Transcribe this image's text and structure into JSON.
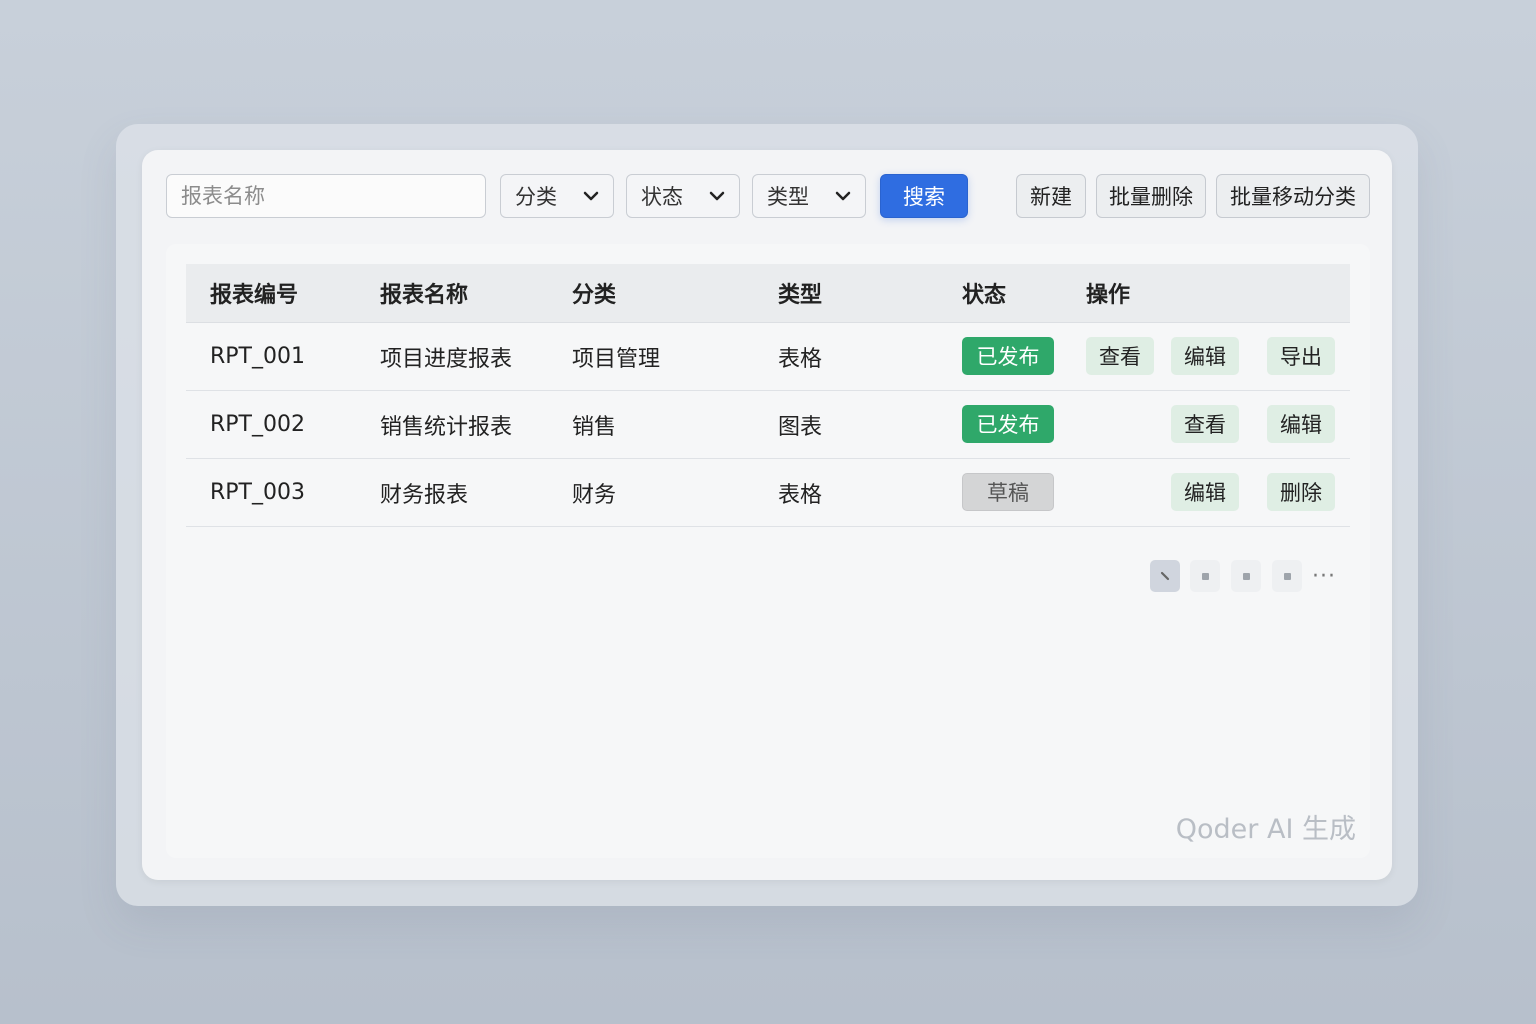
{
  "toolbar": {
    "search_placeholder": "报表名称",
    "filters": [
      "分类",
      "状态",
      "类型"
    ],
    "search_label": "搜索",
    "new_label": "新建",
    "batch_delete_label": "批量删除",
    "batch_move_label": "批量移动分类"
  },
  "table": {
    "headers": [
      "报表编号",
      "报表名称",
      "分类",
      "类型",
      "状态",
      "操作"
    ],
    "rows": [
      {
        "id": "RPT_001",
        "name": "项目进度报表",
        "category": "项目管理",
        "type": "表格",
        "status": "已发布",
        "actions": [
          "查看",
          "编辑",
          "导出"
        ]
      },
      {
        "id": "RPT_002",
        "name": "销售统计报表",
        "category": "销售",
        "type": "图表",
        "status": "已发布",
        "actions": [
          "查看",
          "编辑"
        ]
      },
      {
        "id": "RPT_003",
        "name": "财务报表",
        "category": "财务",
        "type": "表格",
        "status": "草稿",
        "actions": [
          "编辑",
          "删除"
        ]
      }
    ]
  },
  "pagination": {
    "more": "···"
  },
  "watermark": "Qoder AI 生成",
  "colors": {
    "primary": "#2f6de1",
    "published": "#2fa86a",
    "draft": "#d4d5d6",
    "action_bg": "#dfeee4"
  }
}
